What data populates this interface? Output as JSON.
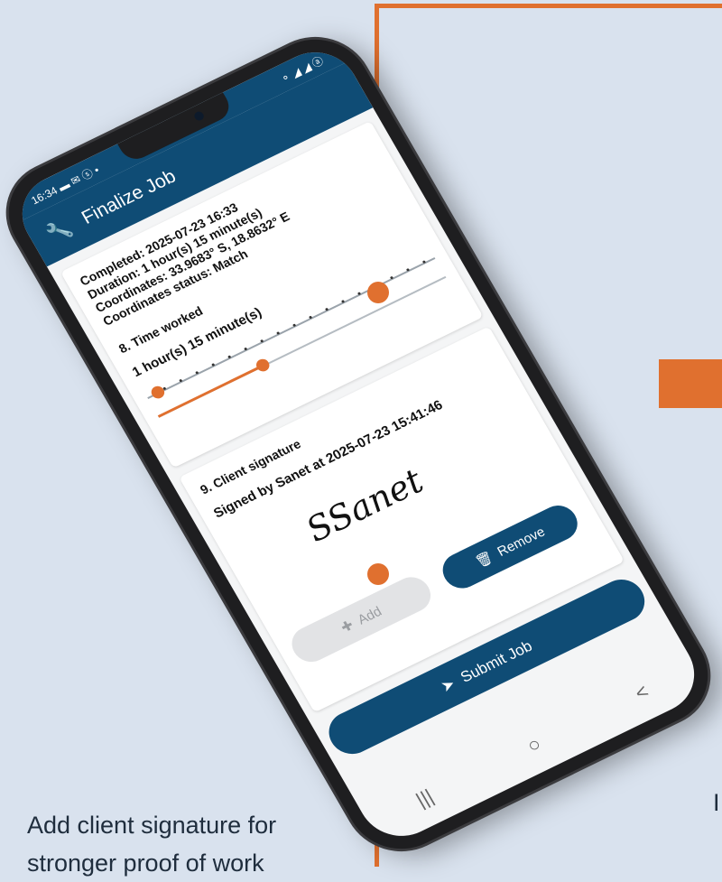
{
  "status_bar": {
    "time": "16:34",
    "left_icons": "▬ ✉ ⓢ •",
    "right_icons": "⚬ ◢ ◢ ⓐ"
  },
  "app_bar": {
    "title": "Finalize Job",
    "icon": "wrench-icon"
  },
  "job_info": {
    "completed": "Completed: 2025-07-23 16:33",
    "duration": "Duration: 1 hour(s) 15 minute(s)",
    "coordinates": "Coordinates: 33.9683° S, 18.8632° E",
    "coordinates_status": "Coordinates status: Match"
  },
  "time_worked": {
    "label": "8. Time worked",
    "value": "1 hour(s) 15 minute(s)"
  },
  "client_signature": {
    "label": "9. Client signature",
    "signed_by": "Signed by Sanet at 2025-07-23 15:41:46",
    "signature_text": "SSanet"
  },
  "buttons": {
    "add": "Add",
    "remove": "Remove",
    "submit": "Submit Job"
  },
  "nav": {
    "recent": "|||",
    "home": "○",
    "back": "<"
  },
  "captions": {
    "left": "Add client signature for stronger proof of work",
    "right": "I m"
  },
  "colors": {
    "accent": "#e0702f",
    "primary": "#0f4c75",
    "background": "#d9e2ee"
  }
}
